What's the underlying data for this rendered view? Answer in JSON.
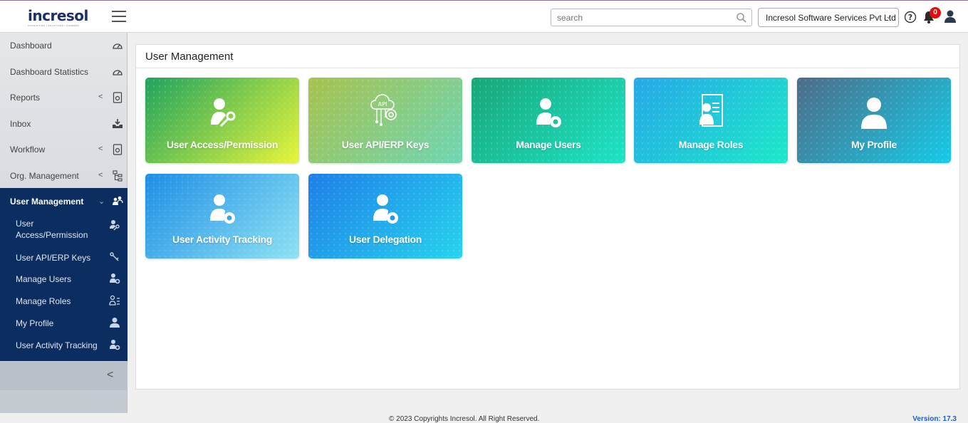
{
  "header": {
    "logo_text": "incresol",
    "logo_tagline": "CONSULTING | SOLUTIONS | CAREERS",
    "search_placeholder": "search",
    "company_name": "Incresol Software Services Pvt Ltd",
    "notification_count": "0"
  },
  "sidebar": {
    "items": [
      {
        "label": "Dashboard",
        "icon": "gauge-icon"
      },
      {
        "label": "Dashboard Statistics",
        "icon": "gauge-icon"
      },
      {
        "label": "Reports",
        "icon": "report-gear-icon"
      },
      {
        "label": "Inbox",
        "icon": "inbox-download-icon"
      },
      {
        "label": "Workflow",
        "icon": "workflow-gear-icon"
      },
      {
        "label": "Org. Management",
        "icon": "org-tree-icon"
      }
    ],
    "active": {
      "label": "User Management",
      "icon": "user-group-icon",
      "sub_items": [
        {
          "label": "User Access/Permission",
          "icon": "user-key-icon"
        },
        {
          "label": "User API/ERP Keys",
          "icon": "key-icon"
        },
        {
          "label": "Manage Users",
          "icon": "user-gear-icon"
        },
        {
          "label": "Manage Roles",
          "icon": "user-list-icon"
        },
        {
          "label": "My Profile",
          "icon": "user-icon"
        },
        {
          "label": "User Activity Tracking",
          "icon": "user-gear-icon"
        }
      ]
    }
  },
  "main": {
    "title": "User Management",
    "cards": [
      {
        "label": "User Access/Permission",
        "icon": "user-key-icon",
        "color_from": "#1fa35f",
        "color_to": "#e8f53a"
      },
      {
        "label": "User API/ERP Keys",
        "icon": "api-cloud-gear-icon",
        "color_from": "#a7c24e",
        "color_to": "#6fd6b5"
      },
      {
        "label": "Manage Users",
        "icon": "user-gear-icon",
        "color_from": "#18a777",
        "color_to": "#1fe4c8"
      },
      {
        "label": "Manage Roles",
        "icon": "user-list-icon",
        "color_from": "#27a8e8",
        "color_to": "#1de9c9"
      },
      {
        "label": "My Profile",
        "icon": "user-icon",
        "color_from": "#4d6c88",
        "color_to": "#16cbe8"
      },
      {
        "label": "User Activity Tracking",
        "icon": "user-gear-icon",
        "color_from": "#1e8fe6",
        "color_to": "#8fe2f2"
      },
      {
        "label": "User Delegation",
        "icon": "user-gear-icon",
        "color_from": "#1e7fe8",
        "color_to": "#28d4ee"
      }
    ]
  },
  "footer": {
    "copyright": "© 2023 Copyrights Incresol. All Right Reserved.",
    "version": "Version: 17.3"
  }
}
